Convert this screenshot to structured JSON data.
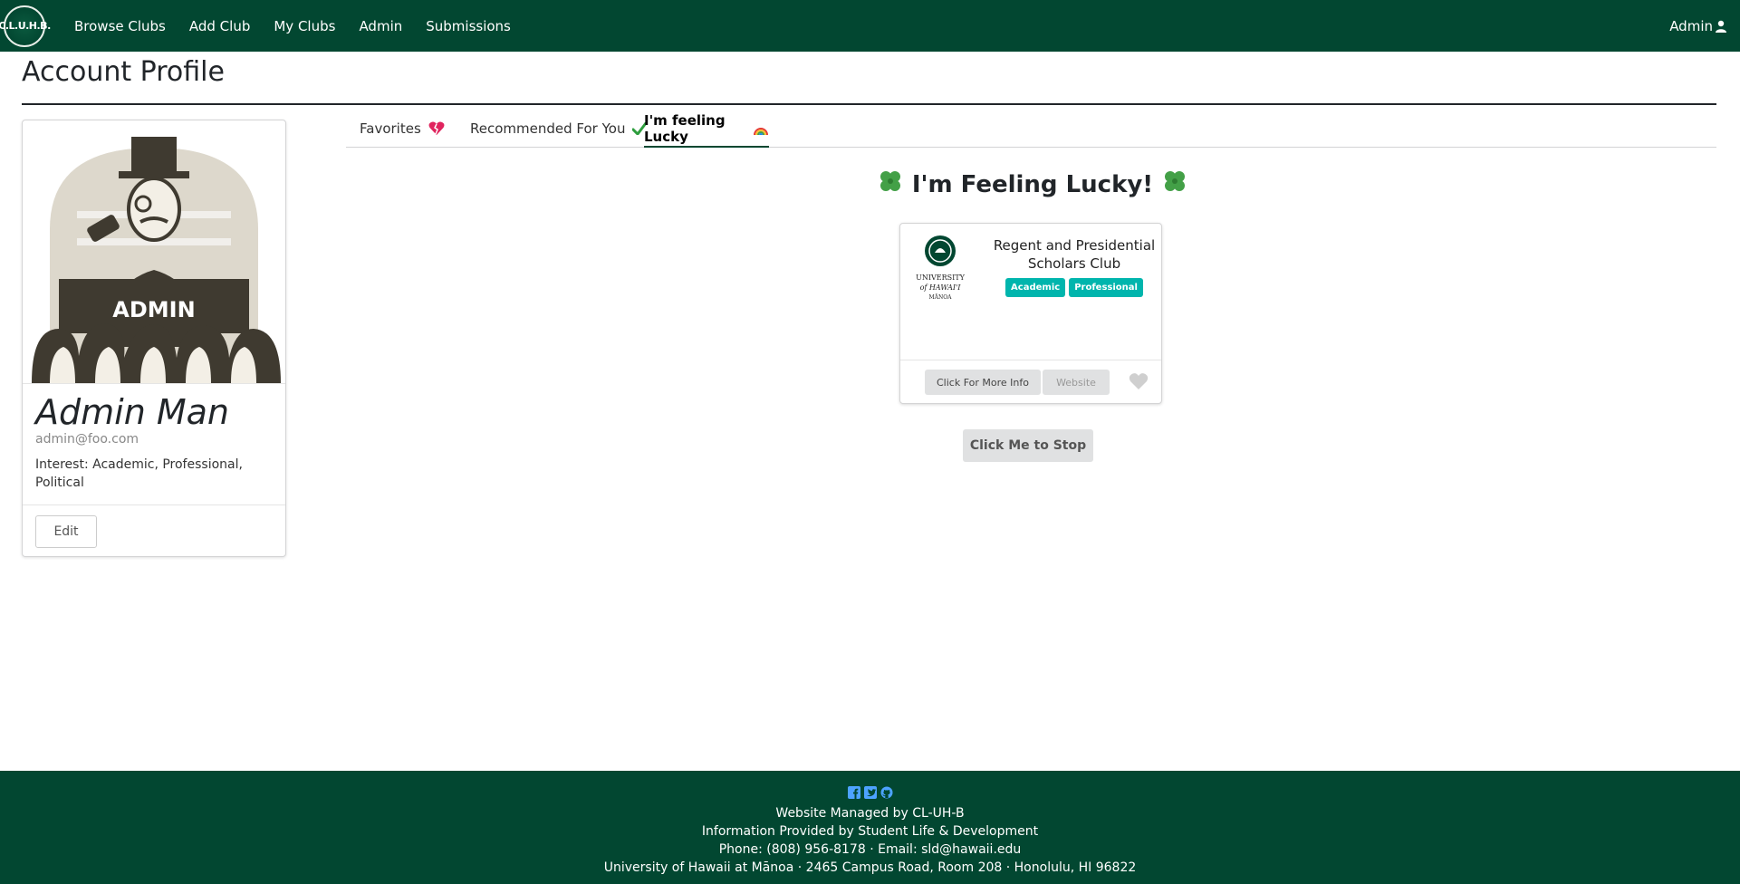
{
  "nav": {
    "logo_text": "C.L.U.H.B.",
    "links": [
      "Browse Clubs",
      "Add Club",
      "My Clubs",
      "Admin",
      "Submissions"
    ],
    "user_label": "Admin"
  },
  "page": {
    "title": "Account Profile"
  },
  "profile": {
    "name": "Admin Man",
    "email": "admin@foo.com",
    "interest": "Interest: Academic, Professional, Political",
    "edit_label": "Edit",
    "avatar_text": "ADMIN"
  },
  "tabs": [
    {
      "label": "Favorites",
      "icon": "broken-heart-icon",
      "active": false
    },
    {
      "label": "Recommended For You",
      "icon": "check-mark-icon",
      "active": false
    },
    {
      "label": "I'm feeling Lucky",
      "icon": "rainbow-icon",
      "active": true
    }
  ],
  "lucky": {
    "heading": "I'm Feeling Lucky!",
    "club": {
      "name": "Regent and Presidential Scholars Club",
      "tags": [
        "Academic",
        "Professional"
      ],
      "logo_lines": [
        "UNIVERSITY",
        "of HAWAI'I",
        "MĀNOA"
      ],
      "info_label": "Click For More Info",
      "website_label": "Website"
    },
    "stop_label": "Click Me to Stop"
  },
  "footer": {
    "line1": "Website Managed by CL-UH-B",
    "line2": "Information Provided by Student Life & Development",
    "line3": "Phone: (808) 956-8178 · Email: sld@hawaii.edu",
    "line4": "University of Hawaii at Mānoa · 2465 Campus Road, Room 208 · Honolulu, HI 96822"
  },
  "colors": {
    "brand": "#024731",
    "tag": "#00b5ad",
    "social": "#4da3ff"
  }
}
